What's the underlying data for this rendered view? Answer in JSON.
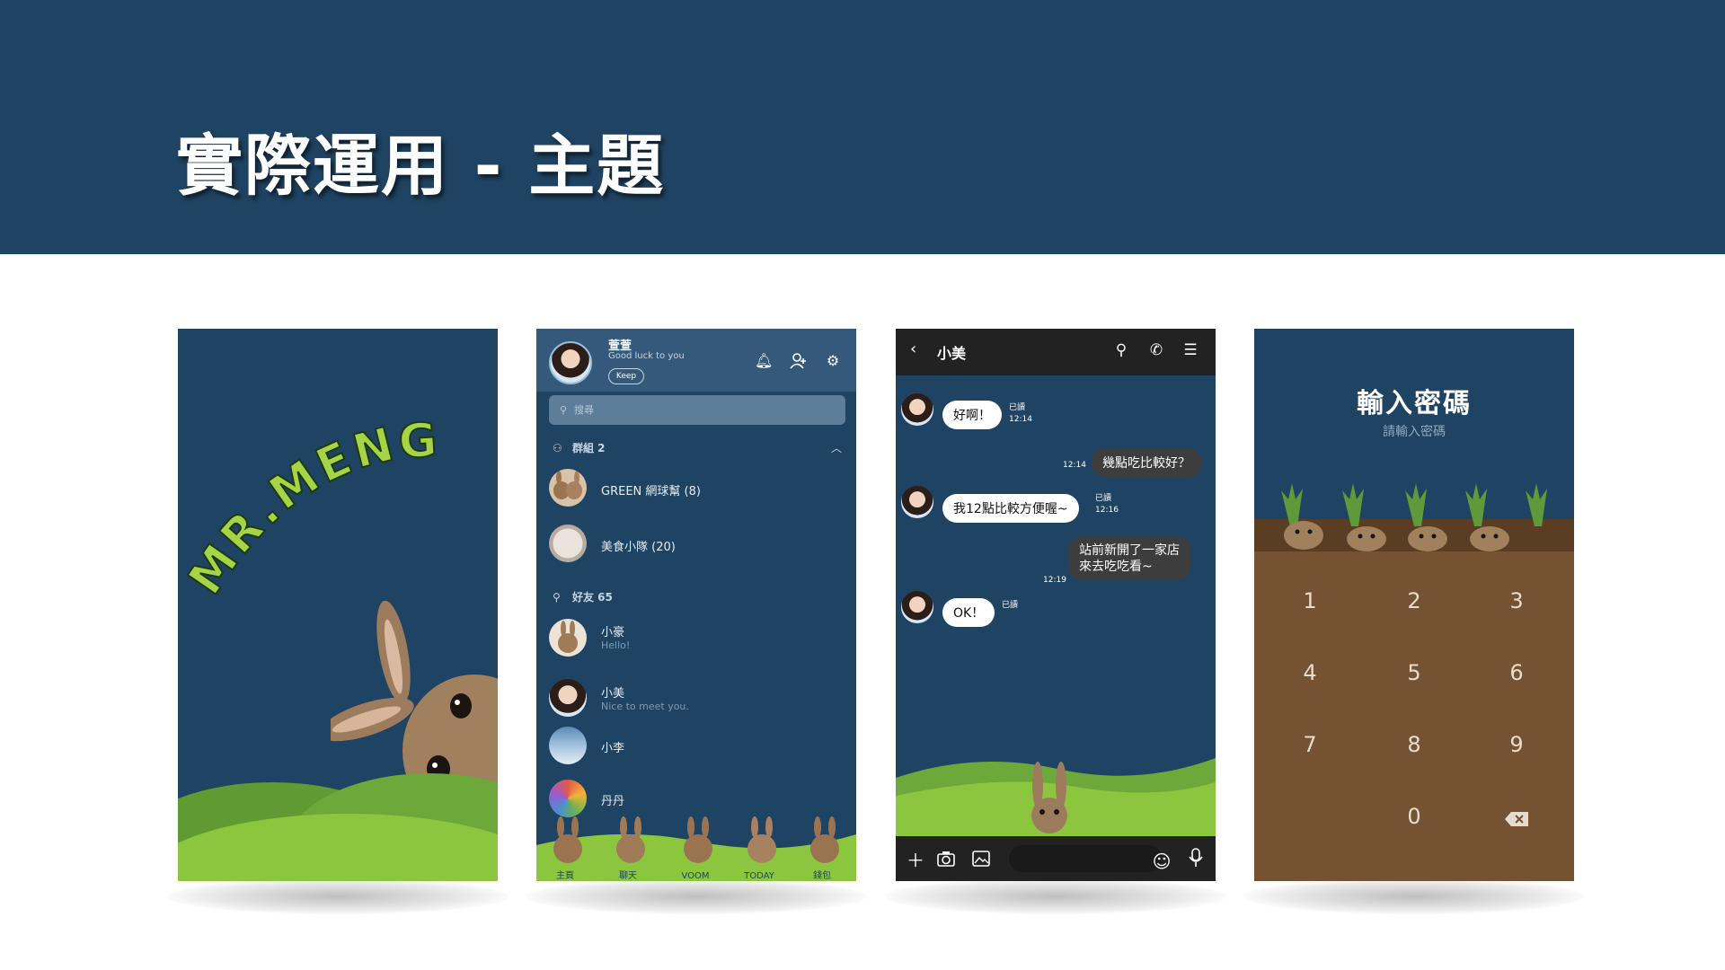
{
  "slide": {
    "title": "實際運用 - 主題"
  },
  "panel_splash": {
    "logo_text": "MR.MENG"
  },
  "panel_friends": {
    "profile": {
      "name": "萱萱",
      "status": "Good luck to you",
      "keep_label": "Keep"
    },
    "search_placeholder": "搜尋",
    "groups_section": "群組 2",
    "groups": [
      {
        "name": "GREEN 網球幫 (8)"
      },
      {
        "name": "美食小隊 (20)"
      }
    ],
    "friends_section": "好友 65",
    "friends": [
      {
        "name": "小豪",
        "status": "Hello!"
      },
      {
        "name": "小美",
        "status": "Nice to meet you."
      },
      {
        "name": "小李",
        "status": ""
      },
      {
        "name": "丹丹",
        "status": ""
      }
    ],
    "tabs": [
      "主頁",
      "聊天",
      "VOOM",
      "TODAY",
      "錢包"
    ]
  },
  "panel_chat": {
    "contact_name": "小美",
    "messages": [
      {
        "dir": "in",
        "text": "好啊！",
        "read": "已讀",
        "time": "12:14"
      },
      {
        "dir": "out",
        "text": "幾點吃比較好？",
        "time": "12:14"
      },
      {
        "dir": "in",
        "text": "我12點比較方便喔~",
        "read": "已讀",
        "time": "12:16"
      },
      {
        "dir": "out",
        "text": "站前新開了一家店",
        "text2": "來去吃吃看~",
        "time": "12:19"
      },
      {
        "dir": "in",
        "text": "OK！",
        "read": "已讀",
        "time": ""
      }
    ]
  },
  "panel_passcode": {
    "title": "輸入密碼",
    "subtitle": "請輸入密碼",
    "keys": [
      "1",
      "2",
      "3",
      "4",
      "5",
      "6",
      "7",
      "8",
      "9",
      "0"
    ]
  },
  "colors": {
    "header_bg": "#1f4362",
    "theme_bg": "#1f4362",
    "grass": "#7db53c",
    "soil": "#745232",
    "chat_bar": "#222222"
  }
}
